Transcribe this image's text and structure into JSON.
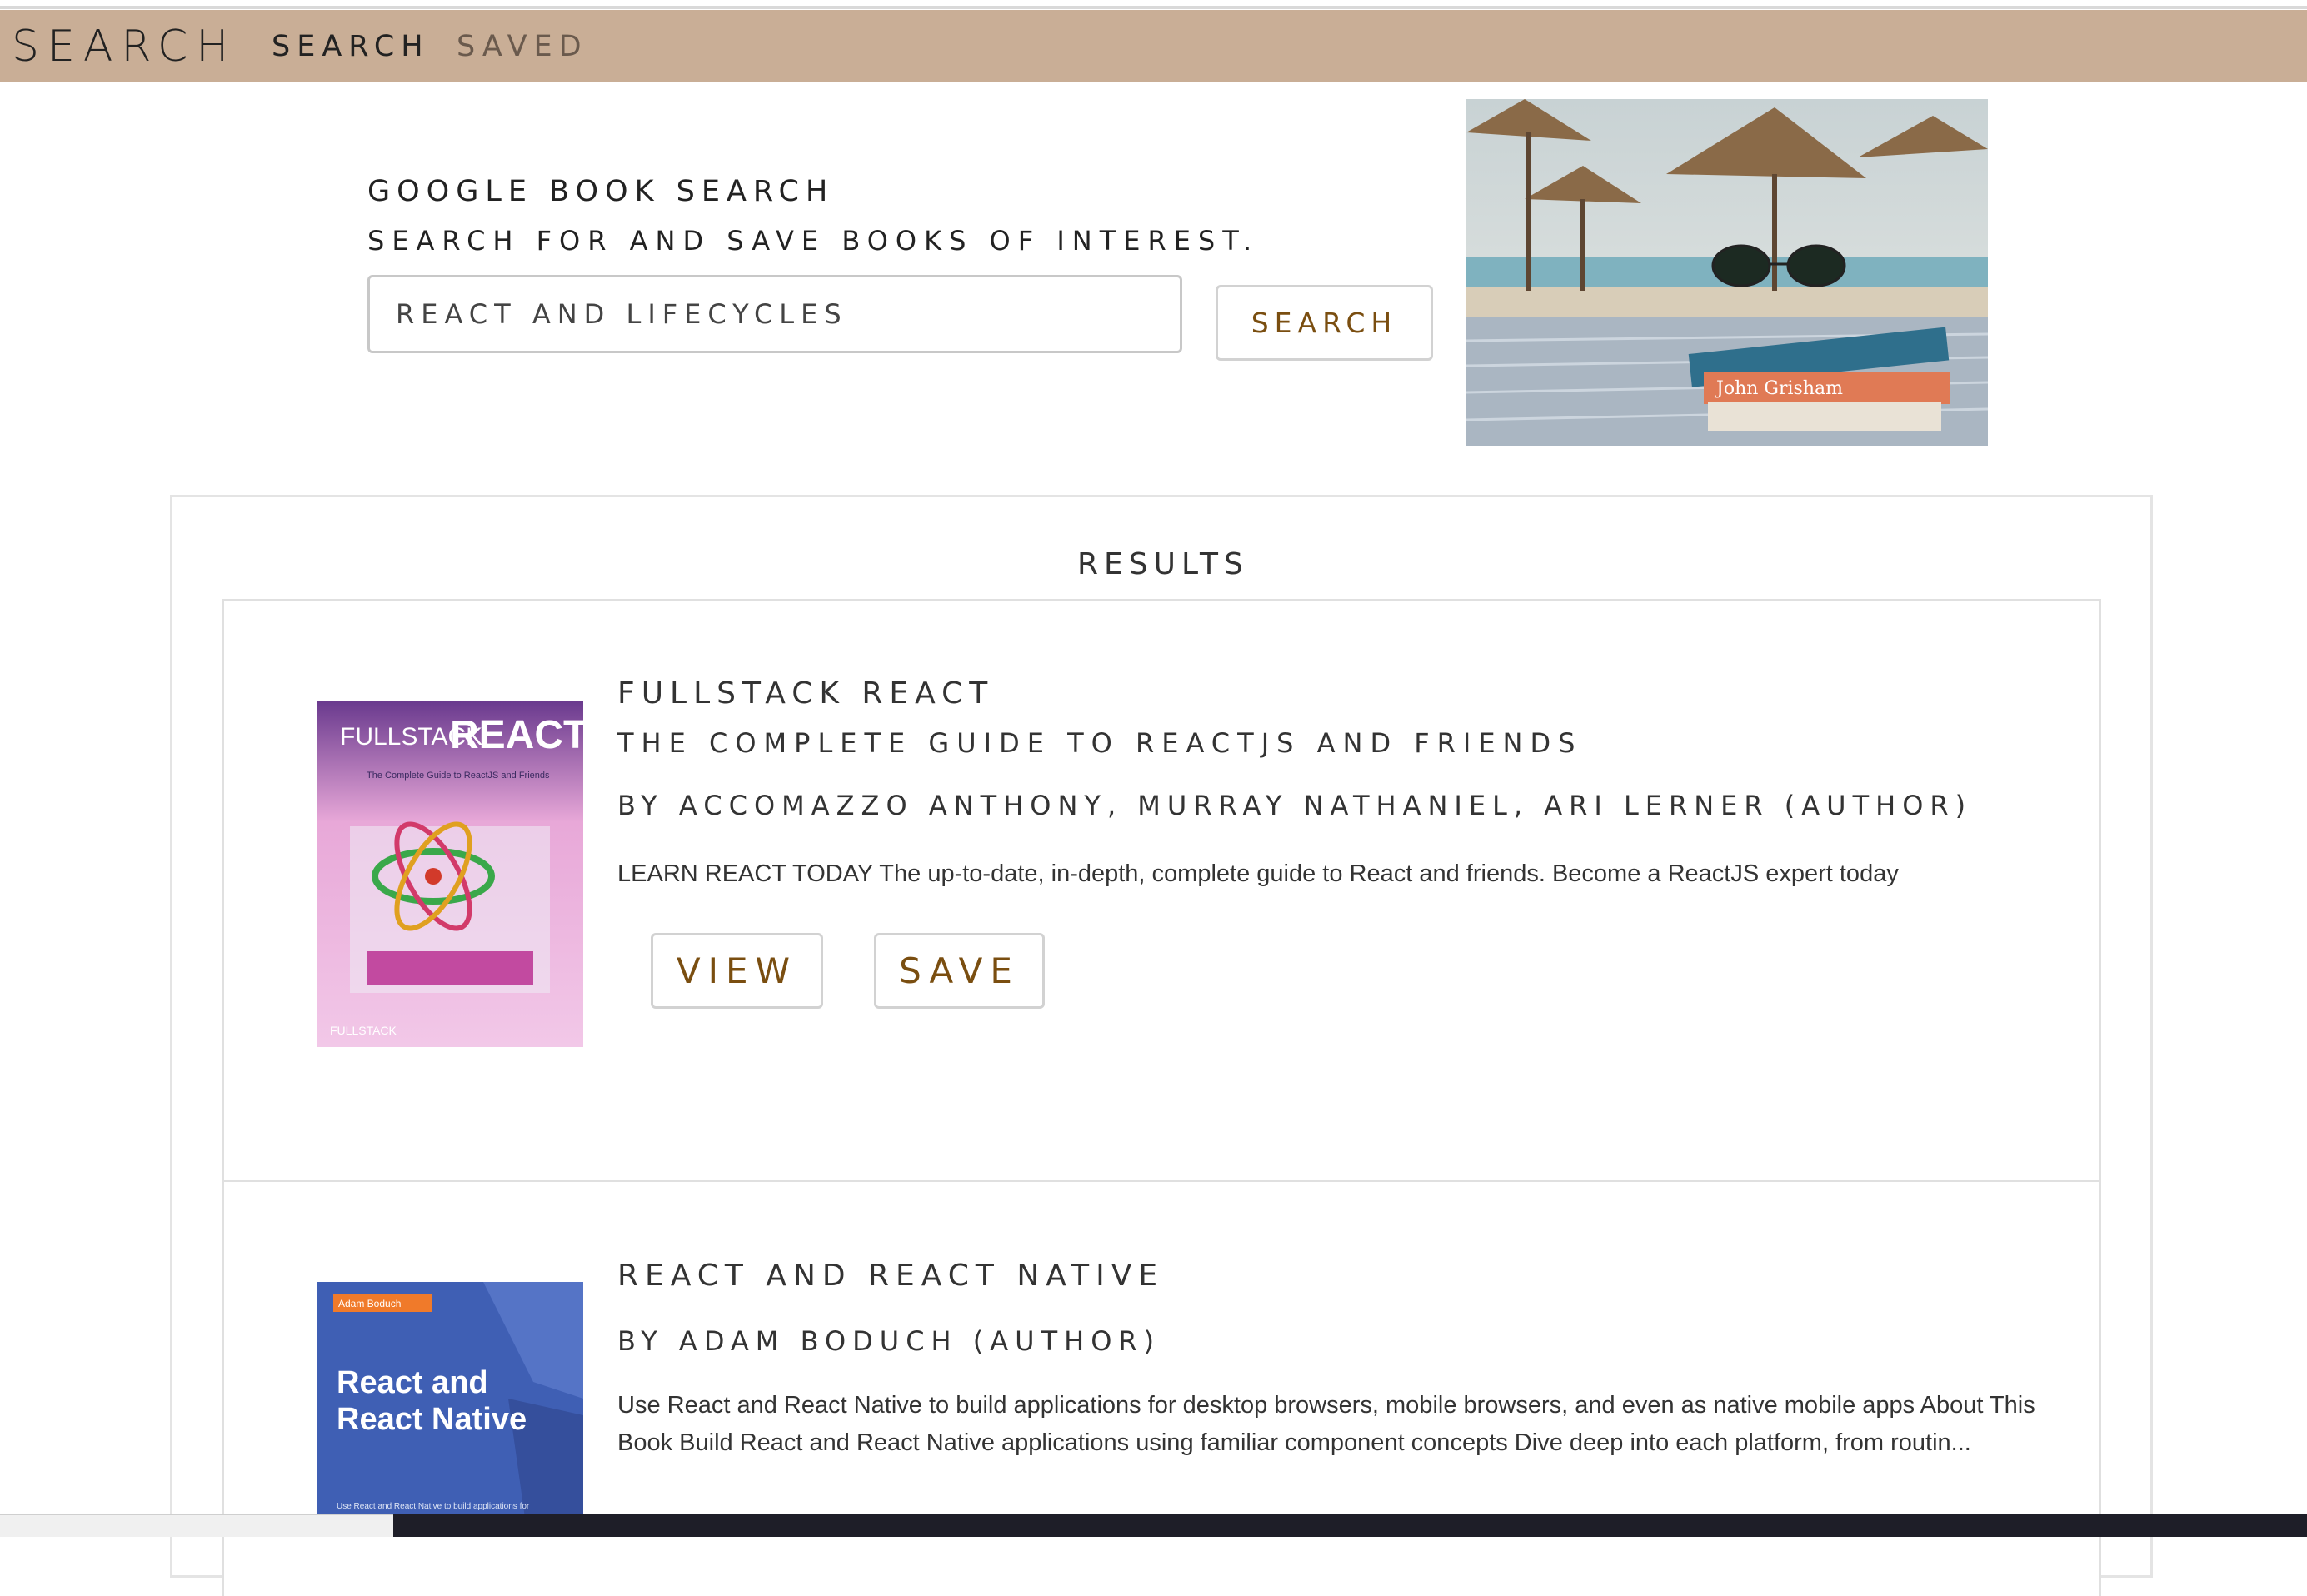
{
  "navbar": {
    "brand": "SEARCH",
    "links": [
      "SEARCH",
      "SAVED"
    ]
  },
  "jumbotron": {
    "title": "GOOGLE BOOK SEARCH",
    "subtitle": "SEARCH FOR AND SAVE BOOKS OF INTEREST.",
    "search_value": "REACT AND LIFECYCLES",
    "search_button": "SEARCH"
  },
  "results": {
    "title": "RESULTS",
    "books": [
      {
        "title": "FULLSTACK REACT",
        "subtitle": "THE COMPLETE GUIDE TO REACTJS AND FRIENDS",
        "authors": "BY ACCOMAZZO ANTHONY, MURRAY NATHANIEL, ARI LERNER (AUTHOR)",
        "description": "LEARN REACT TODAY The up-to-date, in-depth, complete guide to React and friends. Become a ReactJS expert today",
        "cover": {
          "line1": "FULLSTACK",
          "line2": "REACT",
          "tagline": "The Complete Guide to ReactJS and Friends",
          "publisher": "FULLSTACK"
        },
        "view_label": "VIEW",
        "save_label": "SAVE"
      },
      {
        "title": "REACT AND REACT NATIVE",
        "authors": "BY ADAM BODUCH (AUTHOR)",
        "description": "Use React and React Native to build applications for desktop browsers, mobile browsers, and even as native mobile apps About This Book Build React and React Native applications using familiar component concepts Dive deep into each platform, from routin...",
        "cover": {
          "author_tag": "Adam Boduch",
          "line1": "React and",
          "line2": "React Native",
          "footer": "Use React and React Native to build applications for"
        }
      }
    ]
  },
  "hero_image": {
    "book_spines": [
      "John Grisham"
    ]
  },
  "colors": {
    "navbar_bg": "#c9ae96",
    "button_text": "#7a4e10",
    "cover2_bg": "#3f5fb4"
  }
}
